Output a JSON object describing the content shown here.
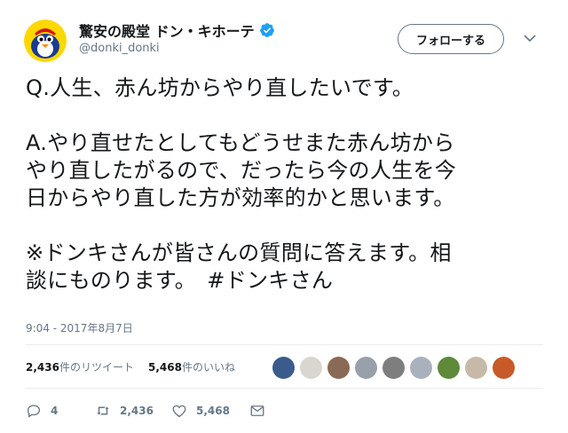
{
  "account": {
    "display_name": "驚安の殿堂 ドン・キホーテ",
    "handle": "@donki_donki",
    "verified": true,
    "verified_color": "#1da1f2"
  },
  "header": {
    "follow_label": "フォローする",
    "menu_icon": "chevron-down-icon"
  },
  "tweet": {
    "lines": [
      "Q.人生、赤ん坊からやり直したいです。",
      "",
      "A.やり直せたとしてもどうせまた赤ん坊から",
      "やり直したがるので、だったら今の人生を今",
      "日からやり直した方が効率的かと思います。",
      "",
      "※ドンキさんが皆さんの質問に答えます。相",
      "談にものります。　#ドンキさん"
    ],
    "timestamp": "9:04 - 2017年8月7日"
  },
  "stats": {
    "retweets_count": "2,436",
    "retweets_label": "件のリツイート",
    "likes_count": "5,468",
    "likes_label": "件のいいね",
    "liker_avatar_colors": [
      "#3b5b8c",
      "#d9d6cf",
      "#8a6a55",
      "#9aa0aa",
      "#7e7e7e",
      "#a9b1bd",
      "#5f8a3a",
      "#c7b9a8",
      "#c85a2a"
    ]
  },
  "actions": {
    "reply_count": "4",
    "retweet_count": "2,436",
    "like_count": "5,468",
    "icons": [
      "reply-icon",
      "retweet-icon",
      "like-icon",
      "message-icon"
    ]
  }
}
